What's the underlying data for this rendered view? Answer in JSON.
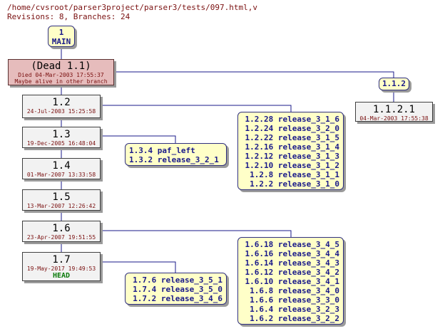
{
  "header": {
    "path": "/home/cvsroot/parser3project/parser3/tests/097.html,v",
    "summary": "Revisions: 8, Branches: 24"
  },
  "branch_main": {
    "num": "1",
    "name": "MAIN"
  },
  "branch_112": {
    "num": "1.1.2"
  },
  "revisions": {
    "r11": {
      "num": "(Dead 1.1)",
      "date": "Died 04-Mar-2003 17:55:37",
      "note": "Maybe alive in other branch"
    },
    "r12": {
      "num": "1.2",
      "date": "24-Jul-2003 15:25:58"
    },
    "r13": {
      "num": "1.3",
      "date": "19-Dec-2005 16:48:04"
    },
    "r14": {
      "num": "1.4",
      "date": "01-Mar-2007 13:33:58"
    },
    "r15": {
      "num": "1.5",
      "date": "13-Mar-2007 12:26:42"
    },
    "r16": {
      "num": "1.6",
      "date": "23-Apr-2007 19:51:55"
    },
    "r17": {
      "num": "1.7",
      "date": "19-May-2017 19:49:53",
      "head": "HEAD"
    },
    "r1121": {
      "num": "1.1.2.1",
      "date": "04-Mar-2003 17:55:38"
    }
  },
  "tags_12": [
    "1.2.28 release_3_1_6",
    "1.2.24 release_3_2_0",
    "1.2.22 release_3_1_5",
    "1.2.16 release_3_1_4",
    "1.2.12 release_3_1_3",
    "1.2.10 release_3_1_2",
    "1.2.8 release_3_1_1",
    "1.2.2 release_3_1_0"
  ],
  "tags_13": [
    "1.3.4 paf_left",
    "1.3.2 release_3_2_1"
  ],
  "tags_16": [
    "1.6.18 release_3_4_5",
    "1.6.16 release_3_4_4",
    "1.6.14 release_3_4_3",
    "1.6.12 release_3_4_2",
    "1.6.10 release_3_4_1",
    "1.6.8 release_3_4_0",
    "1.6.6 release_3_3_0",
    "1.6.4 release_3_2_3",
    "1.6.2 release_3_2_2"
  ],
  "tags_17": [
    "1.7.6 release_3_5_1",
    "1.7.4 release_3_5_0",
    "1.7.2 release_3_4_6"
  ],
  "colors": {
    "line": "#1a1a8a",
    "tag_bg": "#ffffc8",
    "dead_bg": "#e6bcbc",
    "head": "#0a7a0a"
  }
}
